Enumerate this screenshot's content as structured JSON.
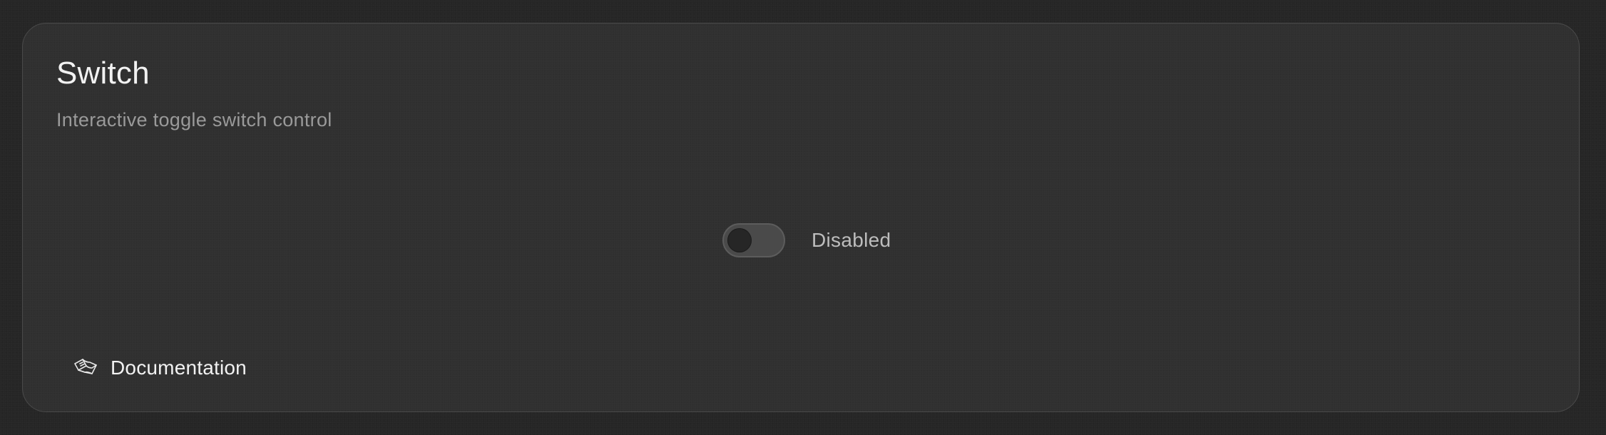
{
  "card": {
    "title": "Switch",
    "subtitle": "Interactive toggle switch control"
  },
  "switch": {
    "label": "Disabled",
    "checked": false,
    "disabled": true
  },
  "footer": {
    "link_label": "Documentation",
    "link_icon": "book-icon"
  },
  "colors": {
    "page_background": "#262626",
    "card_background": "#303030",
    "card_border": "#4a4a4a",
    "title_text": "#f2f2f2",
    "subtitle_text": "#9a9a9a",
    "switch_track": "#4a4a4a",
    "switch_thumb": "#262626"
  }
}
